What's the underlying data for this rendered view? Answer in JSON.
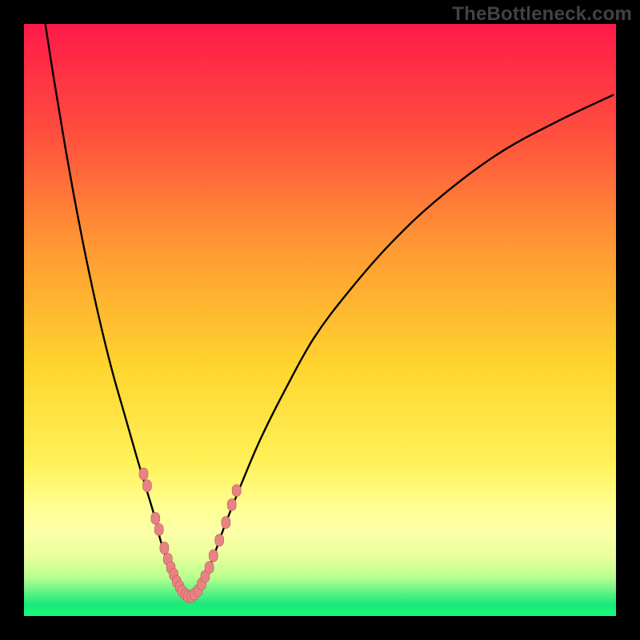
{
  "attribution": "TheBottleneck.com",
  "colors": {
    "frame": "#000000",
    "gradient": {
      "top": "#ff1a4a",
      "mid_upper": "#ff7a36",
      "mid": "#ffd52e",
      "mid_lower": "#fff761",
      "lower_band": "#ffff9c",
      "green": "#19e276",
      "green_bright": "#16ff7e"
    },
    "curve": "#000000",
    "marker": "#e98282",
    "marker_stroke": "#b46161"
  },
  "chart_data": {
    "type": "line",
    "title": "",
    "xlabel": "",
    "ylabel": "",
    "xlim": [
      0,
      100
    ],
    "ylim": [
      0,
      100
    ],
    "note": "Values are pixel-estimated from the image on a 0–100 percentage grid (100 = top / right).",
    "series": [
      {
        "name": "left-curve",
        "x": [
          3.6,
          5,
          7,
          9,
          11,
          13,
          15,
          17,
          19,
          20.5,
          22,
          23,
          24,
          25,
          26,
          26.8
        ],
        "y": [
          100,
          91,
          79,
          68,
          58,
          49,
          41,
          34,
          27,
          22,
          17,
          13,
          9.8,
          6.7,
          4.5,
          3.2
        ]
      },
      {
        "name": "right-curve",
        "x": [
          28.8,
          30,
          32,
          34,
          37,
          40,
          44,
          49,
          55,
          62,
          70,
          80,
          90,
          99.5
        ],
        "y": [
          3.2,
          5,
          10,
          15.5,
          23,
          30,
          38,
          47,
          55,
          63,
          70.5,
          78,
          83.5,
          88
        ]
      }
    ],
    "valley": {
      "x": 27.8,
      "y": 3.2
    },
    "markers_left": {
      "name": "cluster-left",
      "x": [
        20.2,
        20.8,
        22.2,
        22.8,
        23.7,
        24.3,
        24.8,
        25.3,
        25.8,
        26.3,
        26.7,
        27.3,
        27.7
      ],
      "y": [
        24.0,
        22.0,
        16.5,
        14.6,
        11.5,
        9.6,
        8.2,
        7.0,
        5.8,
        4.9,
        4.2,
        3.6,
        3.3
      ]
    },
    "markers_right": {
      "name": "cluster-right",
      "x": [
        28.3,
        28.8,
        29.4,
        30.0,
        30.6,
        31.3,
        32.0,
        33.0,
        34.1,
        35.1,
        35.9
      ],
      "y": [
        3.3,
        3.7,
        4.3,
        5.4,
        6.7,
        8.2,
        10.2,
        12.8,
        15.8,
        18.8,
        21.2
      ]
    }
  }
}
